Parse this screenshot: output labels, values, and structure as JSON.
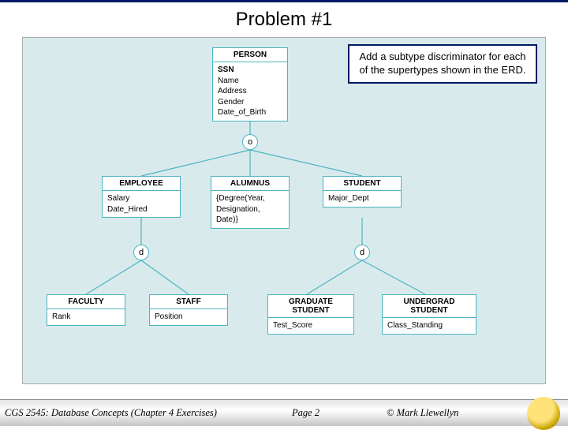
{
  "title": "Problem #1",
  "instruction": "Add a subtype discriminator for each of the supertypes shown in the ERD.",
  "entities": {
    "person": {
      "name": "PERSON",
      "attrs": [
        "SSN",
        "Name",
        "Address",
        "Gender",
        "Date_of_Birth"
      ],
      "pk": "SSN"
    },
    "employee": {
      "name": "EMPLOYEE",
      "attrs": [
        "Salary",
        "Date_Hired"
      ]
    },
    "alumnus": {
      "name": "ALUMNUS",
      "attrs": [
        "{Degree(Year, Designation, Date)}"
      ]
    },
    "student": {
      "name": "STUDENT",
      "attrs": [
        "Major_Dept"
      ]
    },
    "faculty": {
      "name": "FACULTY",
      "attrs": [
        "Rank"
      ]
    },
    "staff": {
      "name": "STAFF",
      "attrs": [
        "Position"
      ]
    },
    "gradstudent": {
      "name": "GRADUATE STUDENT",
      "attrs": [
        "Test_Score"
      ]
    },
    "undergrad": {
      "name": "UNDERGRAD STUDENT",
      "attrs": [
        "Class_Standing"
      ]
    }
  },
  "circles": {
    "o": "o",
    "d1": "d",
    "d2": "d"
  },
  "footer": {
    "course": "CGS 2545: Database Concepts  (Chapter 4 Exercises)",
    "page": "Page 2",
    "copyright": "© Mark Llewellyn"
  }
}
